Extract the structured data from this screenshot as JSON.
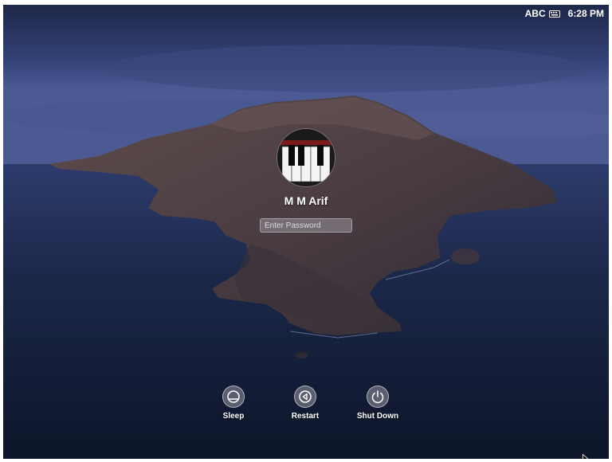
{
  "menubar": {
    "input_source": "ABC",
    "input_icon": "keyboard-icon",
    "time": "6:28 PM"
  },
  "login": {
    "avatar_icon": "piano-keys-avatar",
    "user_name": "M M Arif",
    "password_placeholder": "Enter Password"
  },
  "power": {
    "sleep_label": "Sleep",
    "restart_label": "Restart",
    "shutdown_label": "Shut Down"
  },
  "colors": {
    "text": "#ffffff",
    "sky_top": "#1f2748",
    "horizon": "#3a4a85",
    "sea": "#15203c",
    "island": "#5a4a4a"
  }
}
